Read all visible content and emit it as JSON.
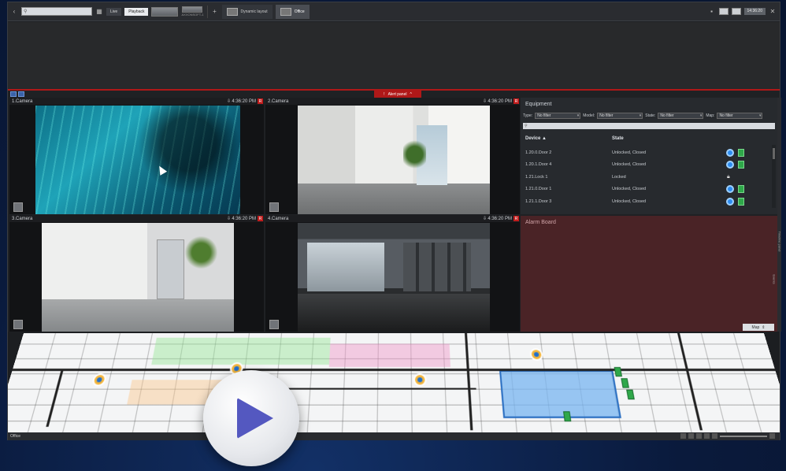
{
  "toolbar": {
    "search_placeholder": "",
    "live_label": "Live",
    "playback_label": "Playback",
    "layout_thumb_label": "AXXONSOFT-1",
    "dynamic_layout_label": "Dynamic layout",
    "office_tab_label": "Office",
    "clock": "14:36:20"
  },
  "alert_panel": {
    "label": "Alert panel"
  },
  "cameras": [
    {
      "name": "1.Camera",
      "time": "4:36:20 PM",
      "rec": "R"
    },
    {
      "name": "2.Camera",
      "time": "4:36:20 PM",
      "rec": "R"
    },
    {
      "name": "3.Camera",
      "time": "4:36:20 PM",
      "rec": "R"
    },
    {
      "name": "4.Camera",
      "time": "4:36:20 PM",
      "rec": "R"
    }
  ],
  "equipment": {
    "title": "Equipment",
    "filters": [
      {
        "label": "Type:",
        "value": "No filter"
      },
      {
        "label": "Model:",
        "value": "No filter"
      },
      {
        "label": "State:",
        "value": "No filter"
      },
      {
        "label": "Map:",
        "value": "No filter"
      }
    ],
    "search_placeholder": "",
    "columns": {
      "device": "Device ▲",
      "state": "State"
    },
    "rows": [
      {
        "device": "1.20.0.Door 2",
        "state": "Unlocked, Closed",
        "icons": "dot-square"
      },
      {
        "device": "1.20.1.Door 4",
        "state": "Unlocked, Closed",
        "icons": "dot-square"
      },
      {
        "device": "1.21.Lock 1",
        "state": "Locked",
        "icons": "lock"
      },
      {
        "device": "1.21.0.Door 1",
        "state": "Unlocked, Closed",
        "icons": "dot-square"
      },
      {
        "device": "1.21.1.Door 3",
        "state": "Unlocked, Closed",
        "icons": "dot-square"
      }
    ]
  },
  "alarm_board": {
    "title": "Alarm Board"
  },
  "side_tabs": {
    "timeline": "Timeline panel",
    "events": "Events"
  },
  "map": {
    "button_label": "Map"
  },
  "statusbar": {
    "layout_name": "Office"
  },
  "colors": {
    "accent_red": "#b01818",
    "status_blue": "#2d8cf0",
    "status_green": "#2fa84a",
    "play_triangle": "#5458c0"
  }
}
